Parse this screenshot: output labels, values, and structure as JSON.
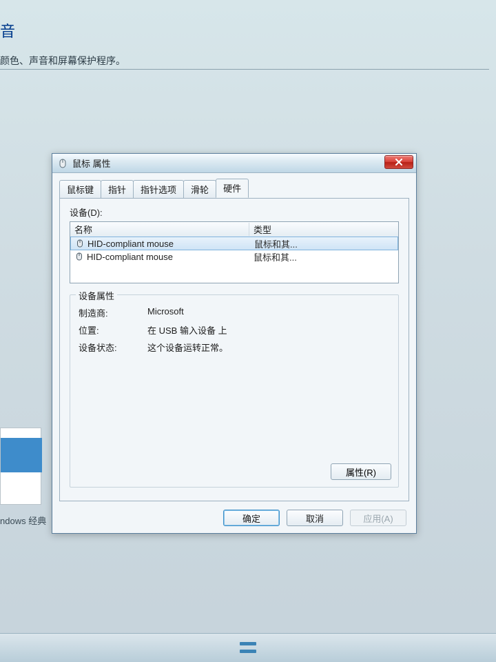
{
  "background": {
    "heading_fragment": "音",
    "subtext_fragment": "颜色、声音和屏幕保护程序。",
    "theme_label_fragment": "ndows 经典"
  },
  "dialog": {
    "title": "鼠标 属性",
    "close_tooltip": "关闭",
    "tabs": [
      {
        "label": "鼠标键",
        "active": false
      },
      {
        "label": "指针",
        "active": false
      },
      {
        "label": "指针选项",
        "active": false
      },
      {
        "label": "滑轮",
        "active": false
      },
      {
        "label": "硬件",
        "active": true
      }
    ],
    "devices_section_label": "设备(D):",
    "columns": {
      "name": "名称",
      "type": "类型"
    },
    "devices": [
      {
        "name": "HID-compliant mouse",
        "type": "鼠标和其...",
        "selected": true
      },
      {
        "name": "HID-compliant mouse",
        "type": "鼠标和其...",
        "selected": false
      }
    ],
    "props": {
      "legend": "设备属性",
      "manufacturer_label": "制造商:",
      "manufacturer_value": "Microsoft",
      "location_label": "位置:",
      "location_value": "在 USB 输入设备 上",
      "status_label": "设备状态:",
      "status_value": "这个设备运转正常。",
      "properties_button": "属性(R)"
    },
    "buttons": {
      "ok": "确定",
      "cancel": "取消",
      "apply": "应用(A)"
    }
  }
}
